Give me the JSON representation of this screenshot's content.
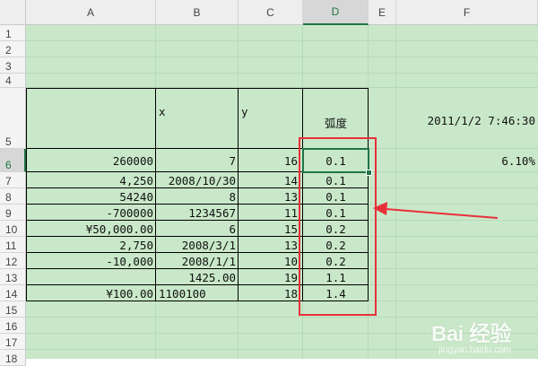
{
  "columns": [
    "A",
    "B",
    "C",
    "D",
    "E",
    "F"
  ],
  "active_column": "D",
  "active_row": "6",
  "rows": [
    "1",
    "2",
    "3",
    "4",
    "5",
    "6",
    "7",
    "8",
    "9",
    "10",
    "11",
    "12",
    "13",
    "14",
    "15",
    "16",
    "17",
    "18"
  ],
  "header_row": {
    "b": "x",
    "c": "y",
    "d": "弧度",
    "f": "2011/1/2 7:46:30"
  },
  "data_rows": [
    {
      "a": "260000",
      "b": "7",
      "c": "16",
      "d": "0.1",
      "f": "6.10%"
    },
    {
      "a": "4,250",
      "b": "2008/10/30",
      "c": "14",
      "d": "0.1"
    },
    {
      "a": "54240",
      "b": "8",
      "c": "13",
      "d": "0.1"
    },
    {
      "a": "-700000",
      "b": "1234567",
      "c": "11",
      "d": "0.1"
    },
    {
      "a": "¥50,000.00",
      "b": "6",
      "c": "15",
      "d": "0.2"
    },
    {
      "a": "2,750",
      "b": "2008/3/1",
      "c": "13",
      "d": "0.2"
    },
    {
      "a": "-10,000",
      "b": "2008/1/1",
      "c": "10",
      "d": "0.2"
    },
    {
      "a": "",
      "b": "1425.00",
      "c": "19",
      "d": "1.1"
    },
    {
      "a": "¥100.00",
      "b": "1100100",
      "c": "18",
      "d": "1.4"
    }
  ],
  "colors": {
    "sheet_bg": "#c9e8c9",
    "selection": "#217346",
    "annotation": "#e8303a"
  },
  "watermark": {
    "logo": "Bai 经验",
    "url": "jingyan.baidu.com"
  }
}
